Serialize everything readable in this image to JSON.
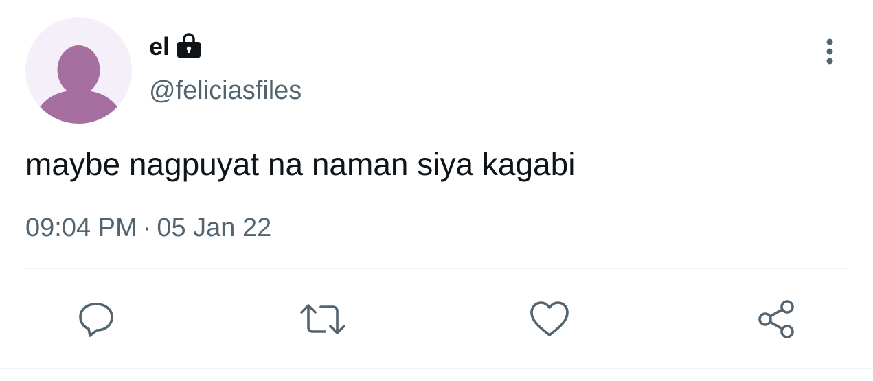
{
  "user": {
    "display_name": "el",
    "handle": "@feliciasfiles",
    "protected_icon": "lock-icon",
    "avatar_icon": "default-avatar-icon"
  },
  "tweet": {
    "text": "maybe nagpuyat na naman siya kagabi",
    "time": "09:04 PM",
    "separator": "·",
    "date": "05 Jan 22"
  },
  "actions": {
    "reply_icon": "reply-icon",
    "retweet_icon": "retweet-icon",
    "like_icon": "heart-icon",
    "share_icon": "share-icon"
  },
  "colors": {
    "text_primary": "#0f1419",
    "text_secondary": "#536471",
    "avatar_bg": "#f5eff9",
    "avatar_fg": "#a5709f",
    "icon": "#536471",
    "divider": "#eff3f4"
  }
}
